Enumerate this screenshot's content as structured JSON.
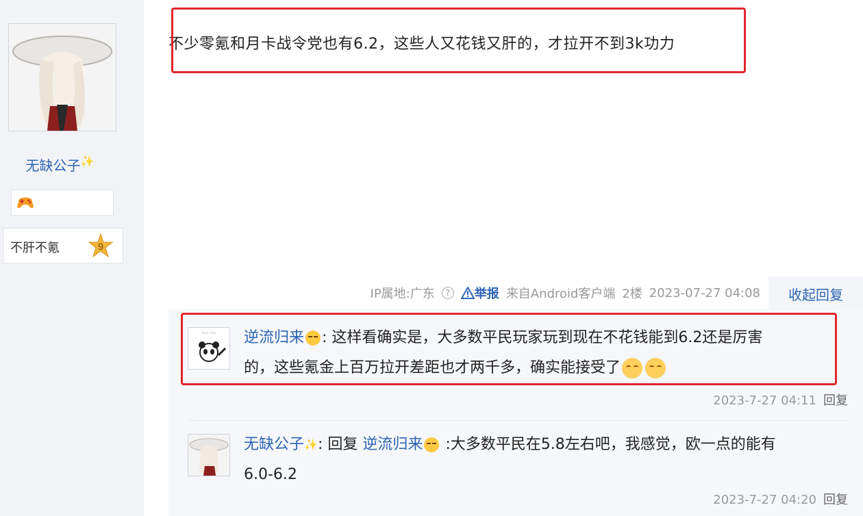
{
  "author": {
    "name": "无缺公子",
    "level_name": "不肝不氪",
    "level": "9"
  },
  "post": {
    "text": "不少零氪和月卡战令党也有6.2，这些人又花钱又肝的，才拉开不到3k功力",
    "meta": {
      "ip": "IP属地:广东",
      "report": "举报",
      "source": "来自Android客户端",
      "floor": "2楼",
      "time": "2023-07-27 04:08"
    },
    "collapse_label": "收起回复"
  },
  "replies": [
    {
      "user": "逆流归来",
      "line1": ": 这样看确实是，大多数平民玩家玩到现在不花钱能到6.2还是厉害",
      "line2": "的，这些氪金上百万拉开差距也才两千多，确实能接受了",
      "time": "2023-7-27 04:11",
      "reply_label": "回复"
    },
    {
      "user": "无缺公子",
      "reply_prefix": ": 回复",
      "target_user": "逆流归来",
      "line1": ":大多数平民在5.8左右吧，我感觉，欧一点的能有",
      "line2": "6.0-6.2",
      "time": "2023-7-27 04:20",
      "reply_label": "回复"
    }
  ],
  "colors": {
    "link_blue": "#2d64b3",
    "highlight_red": "#e0262c",
    "meta_gray": "#999999"
  }
}
